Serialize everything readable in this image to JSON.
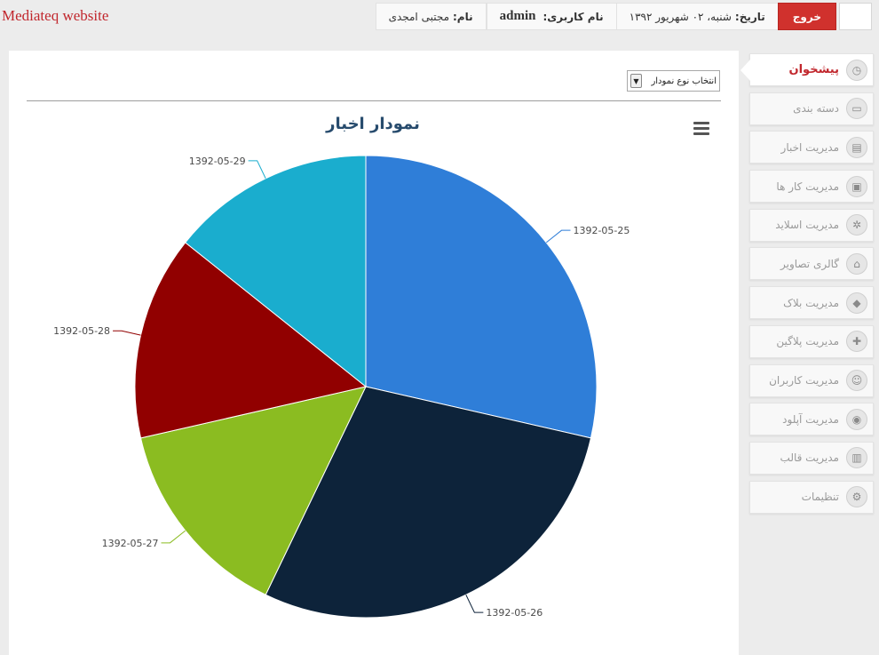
{
  "header": {
    "site_title": "Mediateq website",
    "name_label": "نام:",
    "name_value": "مجتبی امجدی",
    "username_label": "نام کاربری:",
    "username_value": "admin",
    "date_label": "تاریخ:",
    "date_value": "شنبه، ۰۲ شهریور ۱۳۹۲",
    "logout_label": "خروج"
  },
  "chart_select": {
    "selected": "انتخاب نوع نمودار"
  },
  "chart_data": {
    "type": "pie",
    "title": "نمودار اخبار",
    "categories": [
      "1392-05-25",
      "1392-05-26",
      "1392-05-27",
      "1392-05-28",
      "1392-05-29"
    ],
    "values": [
      2,
      2,
      1,
      1,
      1
    ],
    "colors": [
      "#2f7ed8",
      "#0d233a",
      "#8bbc21",
      "#910000",
      "#1aadce"
    ],
    "legend": "none"
  },
  "sidebar": {
    "items": [
      {
        "label": "پیشخوان",
        "icon": "dashboard-icon",
        "active": true
      },
      {
        "label": "دسته بندی",
        "icon": "folder-icon"
      },
      {
        "label": "مدیریت اخبار",
        "icon": "news-icon"
      },
      {
        "label": "مدیریت کار ها",
        "icon": "tasks-icon"
      },
      {
        "label": "مدیریت اسلاید",
        "icon": "slides-icon"
      },
      {
        "label": "گالری تصاویر",
        "icon": "gallery-icon"
      },
      {
        "label": "مدیریت بلاک",
        "icon": "blocks-icon"
      },
      {
        "label": "مدیریت پلاگین",
        "icon": "plugin-icon"
      },
      {
        "label": "مدیریت کاربران",
        "icon": "users-icon"
      },
      {
        "label": "مدیریت آپلود",
        "icon": "upload-icon"
      },
      {
        "label": "مدیریت قالب",
        "icon": "template-icon"
      },
      {
        "label": "تنظیمات",
        "icon": "settings-icon"
      }
    ]
  }
}
